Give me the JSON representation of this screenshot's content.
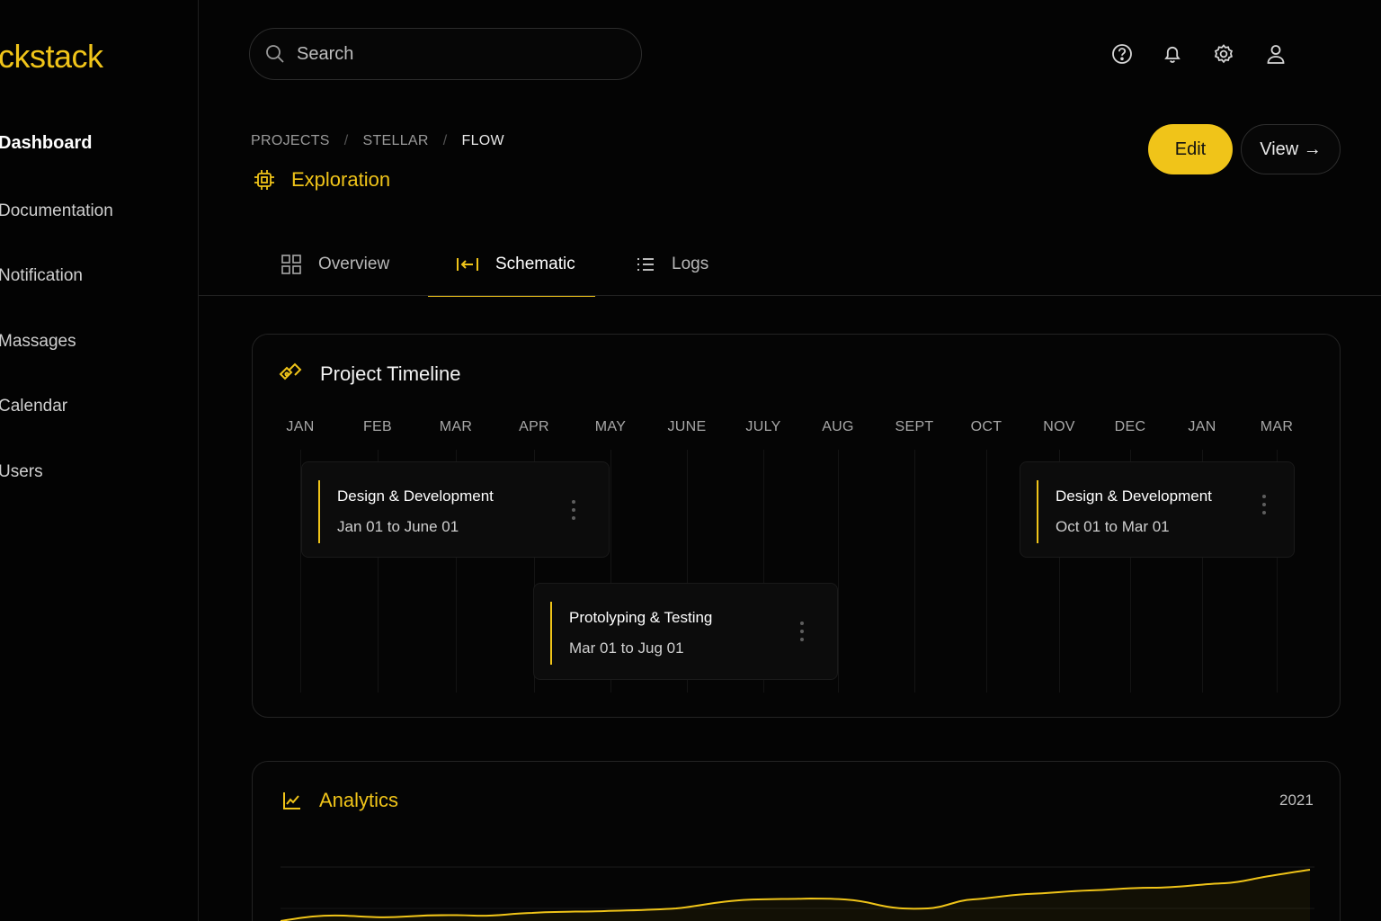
{
  "app": {
    "logo_text": "ckstack",
    "accent": "#f0c419"
  },
  "sidebar": {
    "items": [
      {
        "label": "Dashboard",
        "active": true
      },
      {
        "label": "Documentation"
      },
      {
        "label": "Notification"
      },
      {
        "label": "Massages"
      },
      {
        "label": "Calendar"
      },
      {
        "label": "Users"
      }
    ]
  },
  "topbar": {
    "search_placeholder": "Search",
    "icons": [
      "help-icon",
      "bell-icon",
      "gear-icon",
      "user-icon"
    ]
  },
  "breadcrumb": {
    "items": [
      "PROJECTS",
      "STELLAR",
      "FLOW"
    ],
    "separator": "/"
  },
  "project": {
    "title": "Exploration",
    "icon": "chip-icon"
  },
  "actions": {
    "edit_label": "Edit",
    "view_label": "View →"
  },
  "tabs": [
    {
      "label": "Overview",
      "icon": "grid-icon"
    },
    {
      "label": "Schematic",
      "icon": "collapse-left-icon",
      "active": true
    },
    {
      "label": "Logs",
      "icon": "list-icon"
    }
  ],
  "timeline": {
    "title": "Project Timeline",
    "icon": "timeline-icon",
    "months": [
      "JAN",
      "FEB",
      "MAR",
      "APR",
      "MAY",
      "JUNE",
      "JULY",
      "AUG",
      "SEPT",
      "OCT",
      "NOV",
      "DEC",
      "JAN",
      "MAR"
    ],
    "tasks": [
      {
        "title": "Design & Development",
        "dates": "Jan 01 to June 01"
      },
      {
        "title": "Protolyping & Testing",
        "dates": "Mar 01 to Jug 01"
      },
      {
        "title": "Design & Development",
        "dates": "Oct 01 to Mar 01"
      }
    ]
  },
  "analytics": {
    "title": "Analytics",
    "icon": "line-chart-icon",
    "year": "2021"
  }
}
